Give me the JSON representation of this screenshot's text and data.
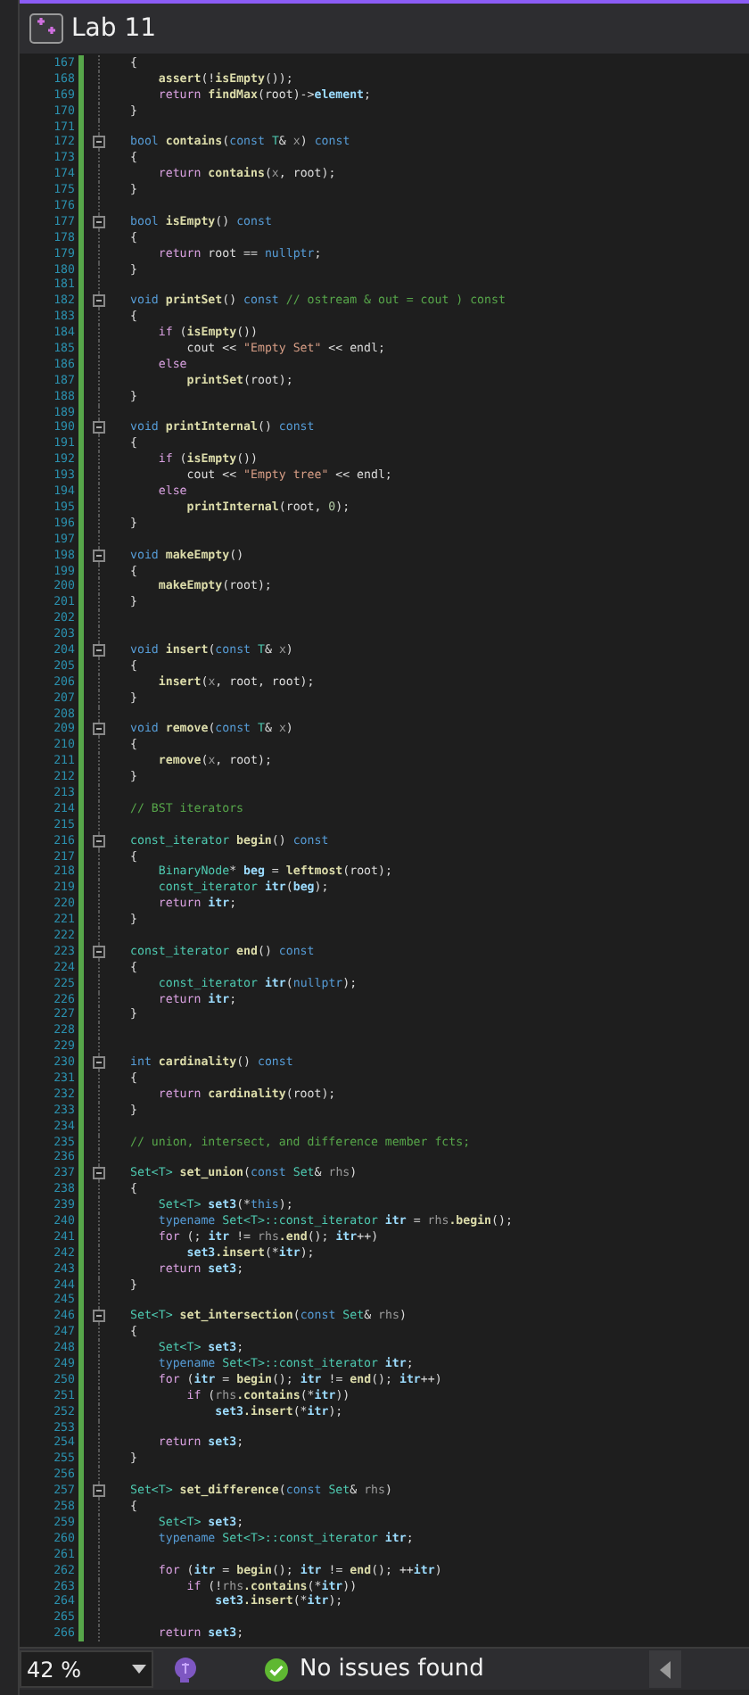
{
  "window": {
    "title": "Lab 11"
  },
  "editor": {
    "lines": [
      {
        "n": "167",
        "fold": false,
        "modified": true,
        "tokens": [
          {
            "text": "{",
            "kind": "plain"
          }
        ]
      },
      {
        "n": "168",
        "fold": false,
        "modified": true,
        "tokens": [
          {
            "text": "    assert",
            "kind": "func"
          },
          {
            "text": "(!",
            "kind": "plain"
          },
          {
            "text": "isEmpty",
            "kind": "func"
          },
          {
            "text": "());",
            "kind": "plain"
          }
        ]
      },
      {
        "n": "169",
        "fold": false,
        "modified": true,
        "tokens": [
          {
            "text": "    return",
            "kind": "control"
          },
          {
            "text": " findMax",
            "kind": "func"
          },
          {
            "text": "(root)->",
            "kind": "plain"
          },
          {
            "text": "element",
            "kind": "var"
          },
          {
            "text": ";",
            "kind": "plain"
          }
        ]
      },
      {
        "n": "170",
        "fold": false,
        "modified": true,
        "tokens": [
          {
            "text": "}",
            "kind": "plain"
          }
        ]
      },
      {
        "n": "171",
        "fold": false,
        "modified": true
      },
      {
        "n": "172",
        "fold": true,
        "modified": true,
        "tokens": [
          {
            "text": "bool",
            "kind": "keyword"
          },
          {
            "text": " contains",
            "kind": "func"
          },
          {
            "text": "(",
            "kind": "plain"
          },
          {
            "text": "const",
            "kind": "keyword"
          },
          {
            "text": " T",
            "kind": "type"
          },
          {
            "text": "& ",
            "kind": "plain"
          },
          {
            "text": "x",
            "kind": "param"
          },
          {
            "text": ") ",
            "kind": "plain"
          },
          {
            "text": "const",
            "kind": "keyword"
          }
        ]
      },
      {
        "n": "173",
        "fold": false,
        "modified": true,
        "tokens": [
          {
            "text": "{",
            "kind": "plain"
          }
        ]
      },
      {
        "n": "174",
        "fold": false,
        "modified": true,
        "tokens": [
          {
            "text": "    return",
            "kind": "control"
          },
          {
            "text": " contains",
            "kind": "func"
          },
          {
            "text": "(",
            "kind": "plain"
          },
          {
            "text": "x",
            "kind": "param"
          },
          {
            "text": ", root);",
            "kind": "plain"
          }
        ]
      },
      {
        "n": "175",
        "fold": false,
        "modified": true,
        "tokens": [
          {
            "text": "}",
            "kind": "plain"
          }
        ]
      },
      {
        "n": "176",
        "fold": false,
        "modified": true
      },
      {
        "n": "177",
        "fold": true,
        "modified": true,
        "tokens": [
          {
            "text": "bool",
            "kind": "keyword"
          },
          {
            "text": " isEmpty",
            "kind": "func"
          },
          {
            "text": "() ",
            "kind": "plain"
          },
          {
            "text": "const",
            "kind": "keyword"
          }
        ]
      },
      {
        "n": "178",
        "fold": false,
        "modified": true,
        "tokens": [
          {
            "text": "{",
            "kind": "plain"
          }
        ]
      },
      {
        "n": "179",
        "fold": false,
        "modified": true,
        "tokens": [
          {
            "text": "    return",
            "kind": "control"
          },
          {
            "text": " root == ",
            "kind": "plain"
          },
          {
            "text": "nullptr",
            "kind": "keyword"
          },
          {
            "text": ";",
            "kind": "plain"
          }
        ]
      },
      {
        "n": "180",
        "fold": false,
        "modified": true,
        "tokens": [
          {
            "text": "}",
            "kind": "plain"
          }
        ]
      },
      {
        "n": "181",
        "fold": false,
        "modified": true
      },
      {
        "n": "182",
        "fold": true,
        "modified": true,
        "tokens": [
          {
            "text": "void",
            "kind": "keyword"
          },
          {
            "text": " printSet",
            "kind": "func"
          },
          {
            "text": "() ",
            "kind": "plain"
          },
          {
            "text": "const",
            "kind": "keyword"
          },
          {
            "text": " // ostream & out = cout ) const",
            "kind": "comment"
          }
        ]
      },
      {
        "n": "183",
        "fold": false,
        "modified": true,
        "tokens": [
          {
            "text": "{",
            "kind": "plain"
          }
        ]
      },
      {
        "n": "184",
        "fold": false,
        "modified": true,
        "tokens": [
          {
            "text": "    if",
            "kind": "control"
          },
          {
            "text": " (",
            "kind": "plain"
          },
          {
            "text": "isEmpty",
            "kind": "func"
          },
          {
            "text": "())",
            "kind": "plain"
          }
        ]
      },
      {
        "n": "185",
        "fold": false,
        "modified": true,
        "tokens": [
          {
            "text": "        cout << ",
            "kind": "plain"
          },
          {
            "text": "\"Empty Set\"",
            "kind": "string"
          },
          {
            "text": " << endl;",
            "kind": "plain"
          }
        ]
      },
      {
        "n": "186",
        "fold": false,
        "modified": true,
        "tokens": [
          {
            "text": "    else",
            "kind": "control"
          }
        ]
      },
      {
        "n": "187",
        "fold": false,
        "modified": true,
        "tokens": [
          {
            "text": "        printSet",
            "kind": "func"
          },
          {
            "text": "(root);",
            "kind": "plain"
          }
        ]
      },
      {
        "n": "188",
        "fold": false,
        "modified": true,
        "tokens": [
          {
            "text": "}",
            "kind": "plain"
          }
        ]
      },
      {
        "n": "189",
        "fold": false,
        "modified": true
      },
      {
        "n": "190",
        "fold": true,
        "modified": true,
        "tokens": [
          {
            "text": "void",
            "kind": "keyword"
          },
          {
            "text": " printInternal",
            "kind": "func"
          },
          {
            "text": "() ",
            "kind": "plain"
          },
          {
            "text": "const",
            "kind": "keyword"
          }
        ]
      },
      {
        "n": "191",
        "fold": false,
        "modified": true,
        "tokens": [
          {
            "text": "{",
            "kind": "plain"
          }
        ]
      },
      {
        "n": "192",
        "fold": false,
        "modified": true,
        "tokens": [
          {
            "text": "    if",
            "kind": "control"
          },
          {
            "text": " (",
            "kind": "plain"
          },
          {
            "text": "isEmpty",
            "kind": "func"
          },
          {
            "text": "())",
            "kind": "plain"
          }
        ]
      },
      {
        "n": "193",
        "fold": false,
        "modified": true,
        "tokens": [
          {
            "text": "        cout << ",
            "kind": "plain"
          },
          {
            "text": "\"Empty tree\"",
            "kind": "string"
          },
          {
            "text": " << endl;",
            "kind": "plain"
          }
        ]
      },
      {
        "n": "194",
        "fold": false,
        "modified": true,
        "tokens": [
          {
            "text": "    else",
            "kind": "control"
          }
        ]
      },
      {
        "n": "195",
        "fold": false,
        "modified": true,
        "tokens": [
          {
            "text": "        printInternal",
            "kind": "func"
          },
          {
            "text": "(root, ",
            "kind": "plain"
          },
          {
            "text": "0",
            "kind": "number"
          },
          {
            "text": ");",
            "kind": "plain"
          }
        ]
      },
      {
        "n": "196",
        "fold": false,
        "modified": true,
        "tokens": [
          {
            "text": "}",
            "kind": "plain"
          }
        ]
      },
      {
        "n": "197",
        "fold": false,
        "modified": true
      },
      {
        "n": "198",
        "fold": true,
        "modified": true,
        "tokens": [
          {
            "text": "void",
            "kind": "keyword"
          },
          {
            "text": " makeEmpty",
            "kind": "func"
          },
          {
            "text": "()",
            "kind": "plain"
          }
        ]
      },
      {
        "n": "199",
        "fold": false,
        "modified": true,
        "tokens": [
          {
            "text": "{",
            "kind": "plain"
          }
        ]
      },
      {
        "n": "200",
        "fold": false,
        "modified": true,
        "tokens": [
          {
            "text": "    makeEmpty",
            "kind": "func"
          },
          {
            "text": "(root);",
            "kind": "plain"
          }
        ]
      },
      {
        "n": "201",
        "fold": false,
        "modified": true,
        "tokens": [
          {
            "text": "}",
            "kind": "plain"
          }
        ]
      },
      {
        "n": "202",
        "fold": false,
        "modified": true
      },
      {
        "n": "203",
        "fold": false,
        "modified": true
      },
      {
        "n": "204",
        "fold": true,
        "modified": true,
        "tokens": [
          {
            "text": "void",
            "kind": "keyword"
          },
          {
            "text": " insert",
            "kind": "func"
          },
          {
            "text": "(",
            "kind": "plain"
          },
          {
            "text": "const",
            "kind": "keyword"
          },
          {
            "text": " T",
            "kind": "type"
          },
          {
            "text": "& ",
            "kind": "plain"
          },
          {
            "text": "x",
            "kind": "param"
          },
          {
            "text": ")",
            "kind": "plain"
          }
        ]
      },
      {
        "n": "205",
        "fold": false,
        "modified": true,
        "tokens": [
          {
            "text": "{",
            "kind": "plain"
          }
        ]
      },
      {
        "n": "206",
        "fold": false,
        "modified": true,
        "tokens": [
          {
            "text": "    insert",
            "kind": "func"
          },
          {
            "text": "(",
            "kind": "plain"
          },
          {
            "text": "x",
            "kind": "param"
          },
          {
            "text": ", root, root);",
            "kind": "plain"
          }
        ]
      },
      {
        "n": "207",
        "fold": false,
        "modified": true,
        "tokens": [
          {
            "text": "}",
            "kind": "plain"
          }
        ]
      },
      {
        "n": "208",
        "fold": false,
        "modified": true
      },
      {
        "n": "209",
        "fold": true,
        "modified": true,
        "tokens": [
          {
            "text": "void",
            "kind": "keyword"
          },
          {
            "text": " remove",
            "kind": "func"
          },
          {
            "text": "(",
            "kind": "plain"
          },
          {
            "text": "const",
            "kind": "keyword"
          },
          {
            "text": " T",
            "kind": "type"
          },
          {
            "text": "& ",
            "kind": "plain"
          },
          {
            "text": "x",
            "kind": "param"
          },
          {
            "text": ")",
            "kind": "plain"
          }
        ]
      },
      {
        "n": "210",
        "fold": false,
        "modified": true,
        "tokens": [
          {
            "text": "{",
            "kind": "plain"
          }
        ]
      },
      {
        "n": "211",
        "fold": false,
        "modified": true,
        "tokens": [
          {
            "text": "    remove",
            "kind": "func"
          },
          {
            "text": "(",
            "kind": "plain"
          },
          {
            "text": "x",
            "kind": "param"
          },
          {
            "text": ", root);",
            "kind": "plain"
          }
        ]
      },
      {
        "n": "212",
        "fold": false,
        "modified": true,
        "tokens": [
          {
            "text": "}",
            "kind": "plain"
          }
        ]
      },
      {
        "n": "213",
        "fold": false,
        "modified": true
      },
      {
        "n": "214",
        "fold": false,
        "modified": true,
        "tokens": [
          {
            "text": "// BST iterators",
            "kind": "comment"
          }
        ]
      },
      {
        "n": "215",
        "fold": false,
        "modified": true
      },
      {
        "n": "216",
        "fold": true,
        "modified": true,
        "tokens": [
          {
            "text": "const_iterator",
            "kind": "type"
          },
          {
            "text": " begin",
            "kind": "func"
          },
          {
            "text": "() ",
            "kind": "plain"
          },
          {
            "text": "const",
            "kind": "keyword"
          }
        ]
      },
      {
        "n": "217",
        "fold": false,
        "modified": true,
        "tokens": [
          {
            "text": "{",
            "kind": "plain"
          }
        ]
      },
      {
        "n": "218",
        "fold": false,
        "modified": true,
        "tokens": [
          {
            "text": "    BinaryNode",
            "kind": "type"
          },
          {
            "text": "* ",
            "kind": "plain"
          },
          {
            "text": "beg",
            "kind": "var"
          },
          {
            "text": " = ",
            "kind": "plain"
          },
          {
            "text": "leftmost",
            "kind": "func"
          },
          {
            "text": "(root);",
            "kind": "plain"
          }
        ]
      },
      {
        "n": "219",
        "fold": false,
        "modified": true,
        "tokens": [
          {
            "text": "    const_iterator",
            "kind": "type"
          },
          {
            "text": " itr",
            "kind": "var"
          },
          {
            "text": "(",
            "kind": "plain"
          },
          {
            "text": "beg",
            "kind": "var"
          },
          {
            "text": ");",
            "kind": "plain"
          }
        ]
      },
      {
        "n": "220",
        "fold": false,
        "modified": true,
        "tokens": [
          {
            "text": "    return",
            "kind": "control"
          },
          {
            "text": " itr",
            "kind": "var"
          },
          {
            "text": ";",
            "kind": "plain"
          }
        ]
      },
      {
        "n": "221",
        "fold": false,
        "modified": true,
        "tokens": [
          {
            "text": "}",
            "kind": "plain"
          }
        ]
      },
      {
        "n": "222",
        "fold": false,
        "modified": true
      },
      {
        "n": "223",
        "fold": true,
        "modified": true,
        "tokens": [
          {
            "text": "const_iterator",
            "kind": "type"
          },
          {
            "text": " end",
            "kind": "func"
          },
          {
            "text": "() ",
            "kind": "plain"
          },
          {
            "text": "const",
            "kind": "keyword"
          }
        ]
      },
      {
        "n": "224",
        "fold": false,
        "modified": true,
        "tokens": [
          {
            "text": "{",
            "kind": "plain"
          }
        ]
      },
      {
        "n": "225",
        "fold": false,
        "modified": true,
        "tokens": [
          {
            "text": "    const_iterator",
            "kind": "type"
          },
          {
            "text": " itr",
            "kind": "var"
          },
          {
            "text": "(",
            "kind": "plain"
          },
          {
            "text": "nullptr",
            "kind": "keyword"
          },
          {
            "text": ");",
            "kind": "plain"
          }
        ]
      },
      {
        "n": "226",
        "fold": false,
        "modified": true,
        "tokens": [
          {
            "text": "    return",
            "kind": "control"
          },
          {
            "text": " itr",
            "kind": "var"
          },
          {
            "text": ";",
            "kind": "plain"
          }
        ]
      },
      {
        "n": "227",
        "fold": false,
        "modified": true,
        "tokens": [
          {
            "text": "}",
            "kind": "plain"
          }
        ]
      },
      {
        "n": "228",
        "fold": false,
        "modified": true
      },
      {
        "n": "229",
        "fold": false,
        "modified": true
      },
      {
        "n": "230",
        "fold": true,
        "modified": true,
        "tokens": [
          {
            "text": "int",
            "kind": "keyword"
          },
          {
            "text": " cardinality",
            "kind": "func"
          },
          {
            "text": "() ",
            "kind": "plain"
          },
          {
            "text": "const",
            "kind": "keyword"
          }
        ]
      },
      {
        "n": "231",
        "fold": false,
        "modified": true,
        "tokens": [
          {
            "text": "{",
            "kind": "plain"
          }
        ]
      },
      {
        "n": "232",
        "fold": false,
        "modified": true,
        "tokens": [
          {
            "text": "    return",
            "kind": "control"
          },
          {
            "text": " cardinality",
            "kind": "func"
          },
          {
            "text": "(root);",
            "kind": "plain"
          }
        ]
      },
      {
        "n": "233",
        "fold": false,
        "modified": true,
        "tokens": [
          {
            "text": "}",
            "kind": "plain"
          }
        ]
      },
      {
        "n": "234",
        "fold": false,
        "modified": true
      },
      {
        "n": "235",
        "fold": false,
        "modified": true,
        "tokens": [
          {
            "text": "// union, intersect, and difference member fcts;",
            "kind": "comment"
          }
        ]
      },
      {
        "n": "236",
        "fold": false,
        "modified": true
      },
      {
        "n": "237",
        "fold": true,
        "modified": true,
        "tokens": [
          {
            "text": "Set<T>",
            "kind": "type"
          },
          {
            "text": " set_union",
            "kind": "func"
          },
          {
            "text": "(",
            "kind": "plain"
          },
          {
            "text": "const",
            "kind": "keyword"
          },
          {
            "text": " Set",
            "kind": "type"
          },
          {
            "text": "& ",
            "kind": "plain"
          },
          {
            "text": "rhs",
            "kind": "param"
          },
          {
            "text": ")",
            "kind": "plain"
          }
        ]
      },
      {
        "n": "238",
        "fold": false,
        "modified": true,
        "tokens": [
          {
            "text": "{",
            "kind": "plain"
          }
        ]
      },
      {
        "n": "239",
        "fold": false,
        "modified": true,
        "tokens": [
          {
            "text": "    Set<T>",
            "kind": "type"
          },
          {
            "text": " set3",
            "kind": "var"
          },
          {
            "text": "(*",
            "kind": "plain"
          },
          {
            "text": "this",
            "kind": "keyword"
          },
          {
            "text": ");",
            "kind": "plain"
          }
        ]
      },
      {
        "n": "240",
        "fold": false,
        "modified": true,
        "tokens": [
          {
            "text": "    typename",
            "kind": "keyword"
          },
          {
            "text": " Set<T>::const_iterator",
            "kind": "type"
          },
          {
            "text": " itr",
            "kind": "var"
          },
          {
            "text": " = ",
            "kind": "plain"
          },
          {
            "text": "rhs",
            "kind": "param"
          },
          {
            "text": ".begin",
            "kind": "func"
          },
          {
            "text": "();",
            "kind": "plain"
          }
        ]
      },
      {
        "n": "241",
        "fold": false,
        "modified": true,
        "tokens": [
          {
            "text": "    for",
            "kind": "control"
          },
          {
            "text": " (; ",
            "kind": "plain"
          },
          {
            "text": "itr",
            "kind": "var"
          },
          {
            "text": " != ",
            "kind": "plain"
          },
          {
            "text": "rhs",
            "kind": "param"
          },
          {
            "text": ".end",
            "kind": "func"
          },
          {
            "text": "(); ",
            "kind": "plain"
          },
          {
            "text": "itr",
            "kind": "var"
          },
          {
            "text": "++)",
            "kind": "plain"
          }
        ]
      },
      {
        "n": "242",
        "fold": false,
        "modified": true,
        "tokens": [
          {
            "text": "        set3",
            "kind": "var"
          },
          {
            "text": ".insert",
            "kind": "func"
          },
          {
            "text": "(*",
            "kind": "plain"
          },
          {
            "text": "itr",
            "kind": "var"
          },
          {
            "text": ");",
            "kind": "plain"
          }
        ]
      },
      {
        "n": "243",
        "fold": false,
        "modified": true,
        "tokens": [
          {
            "text": "    return",
            "kind": "control"
          },
          {
            "text": " set3",
            "kind": "var"
          },
          {
            "text": ";",
            "kind": "plain"
          }
        ]
      },
      {
        "n": "244",
        "fold": false,
        "modified": true,
        "tokens": [
          {
            "text": "}",
            "kind": "plain"
          }
        ]
      },
      {
        "n": "245",
        "fold": false,
        "modified": true
      },
      {
        "n": "246",
        "fold": true,
        "modified": true,
        "tokens": [
          {
            "text": "Set<T>",
            "kind": "type"
          },
          {
            "text": " set_intersection",
            "kind": "func"
          },
          {
            "text": "(",
            "kind": "plain"
          },
          {
            "text": "const",
            "kind": "keyword"
          },
          {
            "text": " Set",
            "kind": "type"
          },
          {
            "text": "& ",
            "kind": "plain"
          },
          {
            "text": "rhs",
            "kind": "param"
          },
          {
            "text": ")",
            "kind": "plain"
          }
        ]
      },
      {
        "n": "247",
        "fold": false,
        "modified": true,
        "tokens": [
          {
            "text": "{",
            "kind": "plain"
          }
        ]
      },
      {
        "n": "248",
        "fold": false,
        "modified": true,
        "tokens": [
          {
            "text": "    Set<T>",
            "kind": "type"
          },
          {
            "text": " set3",
            "kind": "var"
          },
          {
            "text": ";",
            "kind": "plain"
          }
        ]
      },
      {
        "n": "249",
        "fold": false,
        "modified": true,
        "tokens": [
          {
            "text": "    typename",
            "kind": "keyword"
          },
          {
            "text": " Set<T>::const_iterator",
            "kind": "type"
          },
          {
            "text": " itr",
            "kind": "var"
          },
          {
            "text": ";",
            "kind": "plain"
          }
        ]
      },
      {
        "n": "250",
        "fold": false,
        "modified": true,
        "tokens": [
          {
            "text": "    for",
            "kind": "control"
          },
          {
            "text": " (",
            "kind": "plain"
          },
          {
            "text": "itr",
            "kind": "var"
          },
          {
            "text": " = ",
            "kind": "plain"
          },
          {
            "text": "begin",
            "kind": "func"
          },
          {
            "text": "(); ",
            "kind": "plain"
          },
          {
            "text": "itr",
            "kind": "var"
          },
          {
            "text": " != ",
            "kind": "plain"
          },
          {
            "text": "end",
            "kind": "func"
          },
          {
            "text": "(); ",
            "kind": "plain"
          },
          {
            "text": "itr",
            "kind": "var"
          },
          {
            "text": "++)",
            "kind": "plain"
          }
        ]
      },
      {
        "n": "251",
        "fold": false,
        "modified": true,
        "tokens": [
          {
            "text": "        if",
            "kind": "control"
          },
          {
            "text": " (",
            "kind": "plain"
          },
          {
            "text": "rhs",
            "kind": "param"
          },
          {
            "text": ".contains",
            "kind": "func"
          },
          {
            "text": "(*",
            "kind": "plain"
          },
          {
            "text": "itr",
            "kind": "var"
          },
          {
            "text": "))",
            "kind": "plain"
          }
        ]
      },
      {
        "n": "252",
        "fold": false,
        "modified": true,
        "tokens": [
          {
            "text": "            set3",
            "kind": "var"
          },
          {
            "text": ".insert",
            "kind": "func"
          },
          {
            "text": "(*",
            "kind": "plain"
          },
          {
            "text": "itr",
            "kind": "var"
          },
          {
            "text": ");",
            "kind": "plain"
          }
        ]
      },
      {
        "n": "253",
        "fold": false,
        "modified": true
      },
      {
        "n": "254",
        "fold": false,
        "modified": true,
        "tokens": [
          {
            "text": "    return",
            "kind": "control"
          },
          {
            "text": " set3",
            "kind": "var"
          },
          {
            "text": ";",
            "kind": "plain"
          }
        ]
      },
      {
        "n": "255",
        "fold": false,
        "modified": true,
        "tokens": [
          {
            "text": "}",
            "kind": "plain"
          }
        ]
      },
      {
        "n": "256",
        "fold": false,
        "modified": true
      },
      {
        "n": "257",
        "fold": true,
        "modified": true,
        "tokens": [
          {
            "text": "Set<T>",
            "kind": "type"
          },
          {
            "text": " set_difference",
            "kind": "func"
          },
          {
            "text": "(",
            "kind": "plain"
          },
          {
            "text": "const",
            "kind": "keyword"
          },
          {
            "text": " Set",
            "kind": "type"
          },
          {
            "text": "& ",
            "kind": "plain"
          },
          {
            "text": "rhs",
            "kind": "param"
          },
          {
            "text": ")",
            "kind": "plain"
          }
        ]
      },
      {
        "n": "258",
        "fold": false,
        "modified": true,
        "tokens": [
          {
            "text": "{",
            "kind": "plain"
          }
        ]
      },
      {
        "n": "259",
        "fold": false,
        "modified": true,
        "tokens": [
          {
            "text": "    Set<T>",
            "kind": "type"
          },
          {
            "text": " set3",
            "kind": "var"
          },
          {
            "text": ";",
            "kind": "plain"
          }
        ]
      },
      {
        "n": "260",
        "fold": false,
        "modified": true,
        "tokens": [
          {
            "text": "    typename",
            "kind": "keyword"
          },
          {
            "text": " Set<T>::const_iterator",
            "kind": "type"
          },
          {
            "text": " itr",
            "kind": "var"
          },
          {
            "text": ";",
            "kind": "plain"
          }
        ]
      },
      {
        "n": "261",
        "fold": false,
        "modified": true
      },
      {
        "n": "262",
        "fold": false,
        "modified": true,
        "tokens": [
          {
            "text": "    for",
            "kind": "control"
          },
          {
            "text": " (",
            "kind": "plain"
          },
          {
            "text": "itr",
            "kind": "var"
          },
          {
            "text": " = ",
            "kind": "plain"
          },
          {
            "text": "begin",
            "kind": "func"
          },
          {
            "text": "(); ",
            "kind": "plain"
          },
          {
            "text": "itr",
            "kind": "var"
          },
          {
            "text": " != ",
            "kind": "plain"
          },
          {
            "text": "end",
            "kind": "func"
          },
          {
            "text": "(); ++",
            "kind": "plain"
          },
          {
            "text": "itr",
            "kind": "var"
          },
          {
            "text": ")",
            "kind": "plain"
          }
        ]
      },
      {
        "n": "263",
        "fold": false,
        "modified": true,
        "tokens": [
          {
            "text": "        if",
            "kind": "control"
          },
          {
            "text": " (!",
            "kind": "plain"
          },
          {
            "text": "rhs",
            "kind": "param"
          },
          {
            "text": ".contains",
            "kind": "func"
          },
          {
            "text": "(*",
            "kind": "plain"
          },
          {
            "text": "itr",
            "kind": "var"
          },
          {
            "text": "))",
            "kind": "plain"
          }
        ]
      },
      {
        "n": "264",
        "fold": false,
        "modified": true,
        "tokens": [
          {
            "text": "            set3",
            "kind": "var"
          },
          {
            "text": ".insert",
            "kind": "func"
          },
          {
            "text": "(*",
            "kind": "plain"
          },
          {
            "text": "itr",
            "kind": "var"
          },
          {
            "text": ");",
            "kind": "plain"
          }
        ]
      },
      {
        "n": "265",
        "fold": false,
        "modified": true
      },
      {
        "n": "266",
        "fold": false,
        "modified": true,
        "tokens": [
          {
            "text": "    return",
            "kind": "control"
          },
          {
            "text": " set3",
            "kind": "var"
          },
          {
            "text": ";",
            "kind": "plain"
          }
        ]
      }
    ]
  },
  "status_bar": {
    "zoom": "42 %",
    "issues": "No issues found"
  }
}
